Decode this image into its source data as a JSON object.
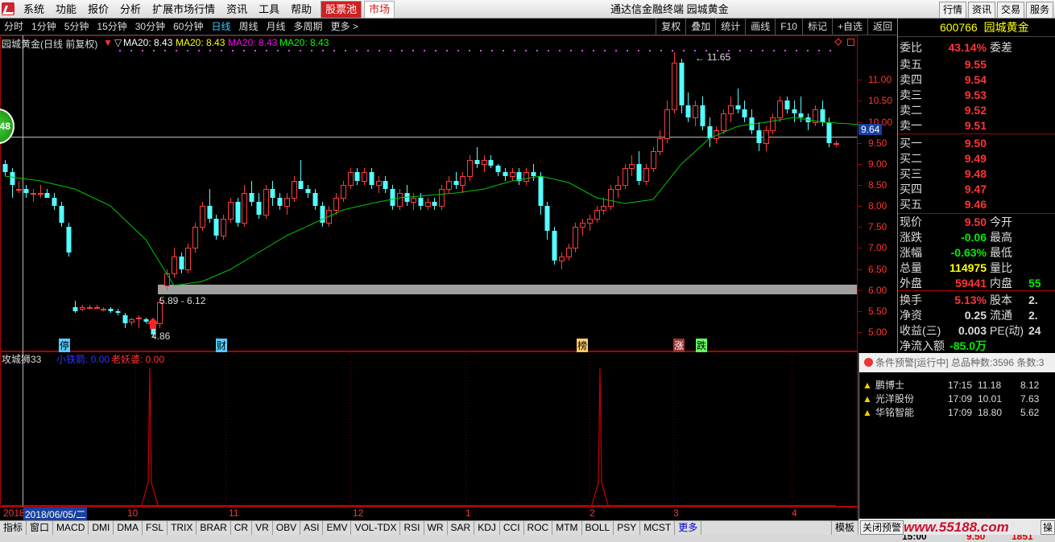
{
  "menubar": {
    "items": [
      "系统",
      "功能",
      "报价",
      "分析",
      "扩展市场行情",
      "资讯",
      "工具",
      "帮助"
    ],
    "hot1": "股票池",
    "hot2": "市场",
    "title": "通达信金融终端  园城黄金",
    "right_buttons": [
      "行情",
      "资讯",
      "交易",
      "服务"
    ]
  },
  "periodbar": {
    "periods": [
      "分时",
      "1分钟",
      "5分钟",
      "15分钟",
      "30分钟",
      "60分钟",
      "日线",
      "周线",
      "月线",
      "多周期",
      "更多 >"
    ],
    "active": "日线",
    "tools": [
      "复权",
      "叠加",
      "统计",
      "画线",
      "F10",
      "标记",
      "+自选",
      "返回"
    ]
  },
  "chart_header": {
    "name": "园城黄金(日线 前复权)",
    "ma1": "MA20: 8.43",
    "ma2": "MA20: 8.43",
    "ma3": "MA20: 8.43",
    "ma4": "MA20: 8.43"
  },
  "price_axis": [
    "11.00",
    "10.50",
    "10.00",
    "9.50",
    "9.00",
    "8.50",
    "8.00",
    "7.50",
    "7.00",
    "6.50",
    "6.00",
    "5.50",
    "5.00"
  ],
  "annotations": {
    "high": "11.65",
    "low": "4.86",
    "gap": "5.89 - 6.12",
    "crosshair": "9.64",
    "circle_badge": "48"
  },
  "markers": [
    "停",
    "财",
    "榜",
    "涨",
    "跌"
  ],
  "indicator_header": {
    "name": "攻城狮33",
    "l1": "小铁箭: 0.00",
    "l2": "老妖婆: 0.00"
  },
  "date_axis": {
    "first": "2018",
    "cursor": "2018/06/05/二",
    "ticks": [
      "10",
      "11",
      "12",
      "1",
      "2",
      "3",
      "4"
    ]
  },
  "quote": {
    "code": "600766",
    "name": "园城黄金",
    "weibi_label": "委比",
    "weibi": "43.14%",
    "weicha_label": "委差",
    "asks": [
      [
        "卖五",
        "9.55"
      ],
      [
        "卖四",
        "9.54"
      ],
      [
        "卖三",
        "9.53"
      ],
      [
        "卖二",
        "9.52"
      ],
      [
        "卖一",
        "9.51"
      ]
    ],
    "bids": [
      [
        "买一",
        "9.50"
      ],
      [
        "买二",
        "9.49"
      ],
      [
        "买三",
        "9.48"
      ],
      [
        "买四",
        "9.47"
      ],
      [
        "买五",
        "9.46"
      ]
    ],
    "stats": [
      [
        "现价",
        "9.50",
        "今开",
        ""
      ],
      [
        "涨跌",
        "-0.06",
        "最高",
        ""
      ],
      [
        "涨幅",
        "-0.63%",
        "最低",
        ""
      ],
      [
        "总量",
        "114975",
        "量比",
        ""
      ],
      [
        "外盘",
        "59441",
        "内盘",
        "55"
      ],
      [
        "换手",
        "5.13%",
        "股本",
        "2."
      ],
      [
        "净资",
        "0.25",
        "流通",
        "2."
      ],
      [
        "收益(三)",
        "0.003",
        "PE(动)",
        "24"
      ],
      [
        "净流入额",
        "-85.0万",
        "",
        ""
      ]
    ]
  },
  "alert": {
    "title": "条件预警[运行中] 总品种数:3596 条数:3",
    "rows": [
      {
        "name": "鹏博士",
        "time": "17:15",
        "price": "11.18",
        "chg": "8.12"
      },
      {
        "name": "光洋股份",
        "time": "17:09",
        "price": "10.01",
        "chg": "7.63"
      },
      {
        "name": "华铭智能",
        "time": "17:09",
        "price": "18.80",
        "chg": "5.62"
      }
    ]
  },
  "tabs": [
    "指标",
    "窗口",
    "MACD",
    "DMI",
    "DMA",
    "FSL",
    "TRIX",
    "BRAR",
    "CR",
    "VR",
    "OBV",
    "ASI",
    "EMV",
    "VOL-TDX",
    "RSI",
    "WR",
    "SAR",
    "KDJ",
    "CCI",
    "ROC",
    "MTM",
    "BOLL",
    "PSY",
    "MCST",
    "更多",
    "模板"
  ],
  "bottom": {
    "close_alert": "关闭预警",
    "site": "www.55188.com",
    "op": "操",
    "time": "15:00",
    "p1": "9.50",
    "p2": "1851"
  },
  "colors": {
    "up": "#ff3c3c",
    "down": "#54ffff",
    "ma": "#00c800",
    "gap": "#a0a0a0",
    "quote_up": "#ff3232",
    "quote_down": "#00e600",
    "indicator": "#c80000"
  },
  "chart_data": {
    "type": "candlestick",
    "y_axis_range": [
      4.75,
      11.75
    ],
    "ohlc": [
      [
        9.0,
        9.1,
        8.7,
        8.8
      ],
      [
        8.8,
        8.9,
        8.2,
        8.5
      ],
      [
        8.4,
        8.6,
        8.3,
        8.4
      ],
      [
        8.4,
        8.5,
        8.2,
        8.3
      ],
      [
        8.3,
        8.4,
        8.1,
        8.3
      ],
      [
        8.3,
        8.5,
        8.2,
        8.3
      ],
      [
        8.3,
        8.4,
        8.2,
        8.2
      ],
      [
        8.2,
        8.3,
        7.9,
        8.0
      ],
      [
        8.0,
        8.1,
        7.5,
        7.6
      ],
      [
        7.5,
        7.6,
        6.8,
        6.9
      ],
      [
        5.6,
        5.75,
        5.45,
        5.5
      ],
      [
        5.55,
        5.65,
        5.5,
        5.6
      ],
      [
        5.6,
        5.65,
        5.55,
        5.6
      ],
      [
        5.6,
        5.65,
        5.55,
        5.6
      ],
      [
        5.55,
        5.6,
        5.5,
        5.55
      ],
      [
        5.55,
        5.6,
        5.45,
        5.5
      ],
      [
        5.5,
        5.55,
        5.4,
        5.45
      ],
      [
        5.4,
        5.45,
        5.1,
        5.2
      ],
      [
        5.25,
        5.35,
        5.15,
        5.3
      ],
      [
        5.35,
        5.4,
        5.1,
        5.35
      ],
      [
        5.3,
        5.35,
        5.2,
        5.25
      ],
      [
        5.2,
        5.3,
        4.86,
        4.95
      ],
      [
        5.2,
        5.8,
        5.1,
        5.7
      ],
      [
        6.1,
        6.5,
        6.0,
        6.4
      ],
      [
        6.4,
        7.0,
        6.3,
        6.8
      ],
      [
        6.8,
        6.9,
        6.4,
        6.5
      ],
      [
        6.5,
        7.1,
        6.4,
        7.0
      ],
      [
        7.0,
        7.6,
        6.9,
        7.5
      ],
      [
        7.5,
        8.1,
        7.4,
        8.0
      ],
      [
        8.0,
        8.4,
        7.6,
        7.7
      ],
      [
        7.7,
        7.8,
        7.2,
        7.3
      ],
      [
        7.3,
        7.8,
        7.2,
        7.7
      ],
      [
        7.7,
        8.2,
        7.6,
        8.1
      ],
      [
        8.1,
        8.2,
        7.5,
        7.6
      ],
      [
        7.6,
        8.5,
        7.5,
        8.3
      ],
      [
        8.3,
        8.6,
        8.0,
        8.1
      ],
      [
        8.1,
        8.3,
        7.7,
        7.8
      ],
      [
        7.8,
        8.5,
        7.7,
        8.4
      ],
      [
        8.4,
        8.6,
        8.0,
        8.2
      ],
      [
        8.2,
        8.3,
        7.9,
        8.0
      ],
      [
        8.0,
        8.3,
        7.8,
        8.2
      ],
      [
        8.2,
        8.7,
        8.1,
        8.6
      ],
      [
        8.6,
        9.1,
        8.5,
        8.4
      ],
      [
        8.4,
        8.5,
        8.2,
        8.3
      ],
      [
        8.3,
        8.4,
        7.9,
        8.0
      ],
      [
        8.0,
        8.1,
        7.5,
        7.6
      ],
      [
        7.6,
        8.0,
        7.5,
        7.9
      ],
      [
        7.9,
        8.3,
        7.8,
        8.2
      ],
      [
        8.2,
        8.6,
        8.1,
        8.5
      ],
      [
        8.5,
        8.9,
        8.4,
        8.8
      ],
      [
        8.8,
        8.9,
        8.5,
        8.6
      ],
      [
        8.6,
        8.9,
        8.5,
        8.8
      ],
      [
        8.8,
        8.9,
        8.4,
        8.5
      ],
      [
        8.5,
        8.7,
        8.3,
        8.6
      ],
      [
        8.6,
        8.7,
        8.3,
        8.4
      ],
      [
        8.4,
        8.5,
        7.9,
        8.0
      ],
      [
        8.0,
        8.4,
        7.9,
        8.3
      ],
      [
        8.3,
        8.5,
        8.0,
        8.1
      ],
      [
        8.1,
        8.3,
        7.9,
        8.2
      ],
      [
        8.2,
        8.3,
        7.9,
        8.0
      ],
      [
        8.0,
        8.2,
        7.9,
        8.1
      ],
      [
        8.1,
        8.2,
        7.9,
        8.0
      ],
      [
        8.0,
        8.5,
        7.9,
        8.4
      ],
      [
        8.4,
        8.7,
        8.3,
        8.6
      ],
      [
        8.6,
        8.8,
        8.4,
        8.5
      ],
      [
        8.5,
        8.8,
        8.3,
        8.7
      ],
      [
        8.7,
        9.2,
        8.6,
        9.1
      ],
      [
        9.1,
        9.4,
        8.9,
        9.0
      ],
      [
        9.0,
        9.2,
        8.8,
        9.1
      ],
      [
        9.1,
        9.2,
        8.9,
        8.95
      ],
      [
        8.95,
        9.0,
        8.7,
        8.8
      ],
      [
        8.8,
        8.9,
        8.6,
        8.7
      ],
      [
        8.7,
        8.9,
        8.6,
        8.8
      ],
      [
        8.8,
        8.9,
        8.5,
        8.6
      ],
      [
        8.6,
        8.9,
        8.5,
        8.8
      ],
      [
        8.8,
        9.0,
        8.6,
        8.7
      ],
      [
        8.7,
        8.8,
        7.8,
        8.0
      ],
      [
        8.0,
        8.1,
        7.2,
        7.4
      ],
      [
        7.4,
        7.5,
        6.6,
        6.7
      ],
      [
        6.7,
        6.9,
        6.5,
        6.8
      ],
      [
        6.8,
        7.1,
        6.7,
        7.0
      ],
      [
        7.0,
        7.6,
        6.9,
        7.5
      ],
      [
        7.5,
        7.7,
        7.3,
        7.6
      ],
      [
        7.6,
        7.8,
        7.4,
        7.7
      ],
      [
        7.7,
        8.0,
        7.6,
        7.9
      ],
      [
        7.9,
        8.2,
        7.8,
        8.0
      ],
      [
        8.0,
        8.5,
        7.9,
        8.4
      ],
      [
        8.4,
        8.7,
        8.2,
        8.5
      ],
      [
        8.5,
        9.0,
        8.4,
        8.9
      ],
      [
        8.9,
        9.2,
        8.7,
        9.0
      ],
      [
        9.0,
        9.3,
        8.5,
        8.6
      ],
      [
        8.6,
        9.0,
        8.5,
        8.9
      ],
      [
        8.9,
        9.4,
        8.8,
        9.3
      ],
      [
        9.3,
        9.8,
        9.2,
        9.6
      ],
      [
        9.6,
        10.5,
        9.5,
        10.3
      ],
      [
        10.3,
        11.65,
        10.2,
        11.4
      ],
      [
        11.4,
        11.5,
        10.2,
        10.4
      ],
      [
        10.4,
        10.7,
        10.0,
        10.1
      ],
      [
        10.1,
        10.5,
        9.9,
        10.4
      ],
      [
        10.4,
        10.6,
        9.8,
        9.9
      ],
      [
        9.9,
        10.1,
        9.4,
        9.6
      ],
      [
        9.6,
        9.9,
        9.5,
        9.8
      ],
      [
        9.8,
        10.3,
        9.7,
        10.2
      ],
      [
        10.2,
        10.6,
        10.0,
        10.4
      ],
      [
        10.4,
        10.8,
        10.2,
        10.3
      ],
      [
        10.3,
        10.5,
        10.0,
        10.1
      ],
      [
        10.1,
        10.3,
        9.7,
        9.8
      ],
      [
        9.8,
        10.0,
        9.3,
        9.5
      ],
      [
        9.5,
        9.9,
        9.3,
        9.8
      ],
      [
        9.8,
        10.2,
        9.7,
        10.1
      ],
      [
        10.1,
        10.6,
        10.0,
        10.5
      ],
      [
        10.5,
        10.6,
        10.2,
        10.3
      ],
      [
        10.3,
        10.5,
        10.0,
        10.2
      ],
      [
        10.2,
        10.6,
        10.0,
        10.1
      ],
      [
        10.1,
        10.2,
        9.8,
        10.0
      ],
      [
        10.0,
        10.4,
        9.9,
        10.3
      ],
      [
        10.3,
        10.5,
        9.9,
        10.0
      ],
      [
        10.0,
        10.1,
        9.4,
        9.5
      ],
      [
        9.5,
        9.55,
        9.4,
        9.5
      ]
    ],
    "ma20": [
      [
        0,
        8.7
      ],
      [
        5,
        8.6
      ],
      [
        10,
        8.4
      ],
      [
        15,
        8.0
      ],
      [
        20,
        7.2
      ],
      [
        24,
        6.1
      ],
      [
        28,
        6.2
      ],
      [
        32,
        6.5
      ],
      [
        36,
        6.9
      ],
      [
        40,
        7.3
      ],
      [
        44,
        7.6
      ],
      [
        48,
        7.9
      ],
      [
        52,
        8.05
      ],
      [
        56,
        8.2
      ],
      [
        60,
        8.25
      ],
      [
        64,
        8.3
      ],
      [
        68,
        8.4
      ],
      [
        72,
        8.6
      ],
      [
        76,
        8.7
      ],
      [
        80,
        8.55
      ],
      [
        84,
        8.2
      ],
      [
        88,
        8.05
      ],
      [
        92,
        8.15
      ],
      [
        96,
        9.0
      ],
      [
        100,
        9.6
      ],
      [
        104,
        9.9
      ],
      [
        108,
        10.0
      ],
      [
        112,
        10.1
      ],
      [
        116,
        10.0
      ],
      [
        120,
        9.95
      ],
      [
        124,
        9.9
      ]
    ],
    "gap_zone": [
      5.89,
      6.12
    ],
    "indicator_spikes": [
      186,
      745
    ]
  }
}
